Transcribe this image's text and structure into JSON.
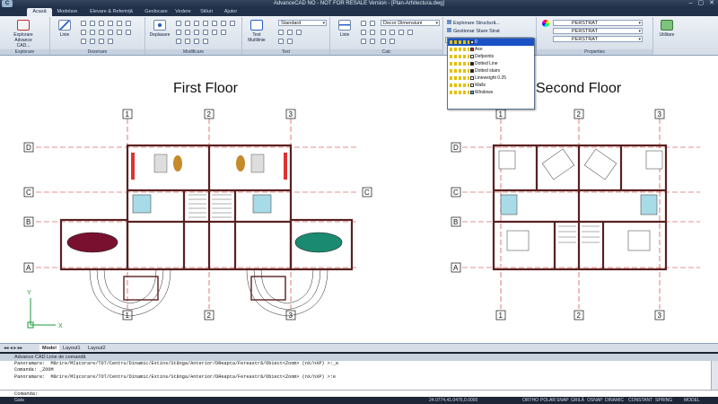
{
  "window": {
    "logo": "C",
    "title": "AdvanceCAD NO - NOT FOR RESALE Version - [Plan-Arhitectura.dwg]",
    "controls": [
      "–",
      "▢",
      "✕"
    ]
  },
  "tabs": [
    "Acasă",
    "Modelare",
    "Elevare & Referință",
    "Geolocare",
    "Vedere",
    "Stiluri",
    "Ajutor"
  ],
  "ribbon": {
    "explorer_label": "Explorare Advance CAD...",
    "group_explorare": "Explorare",
    "group_desenare": "Desenare",
    "group_modificare": "Modificare",
    "group_text": "Text",
    "group_calc": "Calc",
    "group_properties": "Properties",
    "linie_label": "Linie",
    "deplasare_label": "Deplasare",
    "text_multiline_label": "Text Multilinie",
    "text_style": "Standard",
    "dim_style": "Decor Dimensiuni",
    "explorer_structura": "Explorare Structură...",
    "gestionar_stare": "Gestionar Stare Strat",
    "layer_current": "0",
    "linetype": "PERSTRAT",
    "lineweight": "PERSTRAT",
    "color": "PERSTRAT",
    "utilitare_label": "Utilitare"
  },
  "layers": [
    {
      "name": "0",
      "color": "#ffffff"
    },
    {
      "name": "Axe",
      "color": "#e02020"
    },
    {
      "name": "Defpoints",
      "color": "#ffffff"
    },
    {
      "name": "Dotted Line",
      "color": "#1a1a1a"
    },
    {
      "name": "Dotted stairs",
      "color": "#1a1a1a"
    },
    {
      "name": "Lineweight 0.25",
      "color": "#ffffff"
    },
    {
      "name": "Walls",
      "color": "#ffffff"
    },
    {
      "name": "Windows",
      "color": "#22b5e0"
    }
  ],
  "drawing": {
    "first_floor_title": "First Floor",
    "second_floor_title": "Second Floor",
    "grid_cols": [
      "1",
      "2",
      "3"
    ],
    "grid_rows": [
      "D",
      "C",
      "B",
      "A"
    ],
    "ucs_x": "X",
    "ucs_y": "Y"
  },
  "layout_tabs": [
    "Model",
    "Layout1",
    "Layout2"
  ],
  "command": {
    "header": "Advance CAD Linie de comandă",
    "log": [
      "Panoramare:  Mărire/MIșcorare/TOT/Centru/Dinamic/Extins/Stânga/Anterior/DReapta/Fereastră/Obiect<Zoom> (nX/nXP) >:_e",
      "Comanda: _ZOOM",
      "Panoramare:  Mărire/MIșcorare/TOT/Centru/Dinamic/Extins/Stânga/Anterior/DReapta/Fereastră/Obiect<Zoom> (nX/nXP) >:e"
    ],
    "prompt": "Comanda:"
  },
  "status": {
    "left": "Gata",
    "coords": "24.0774,41.0476,0.0000",
    "toggles": [
      "ORTHO",
      "POLAR",
      "SNAP",
      "GRILĂ",
      "OSNAP",
      "DINAMIC",
      "CONSTANT",
      "SPRING",
      "MODEL"
    ]
  }
}
